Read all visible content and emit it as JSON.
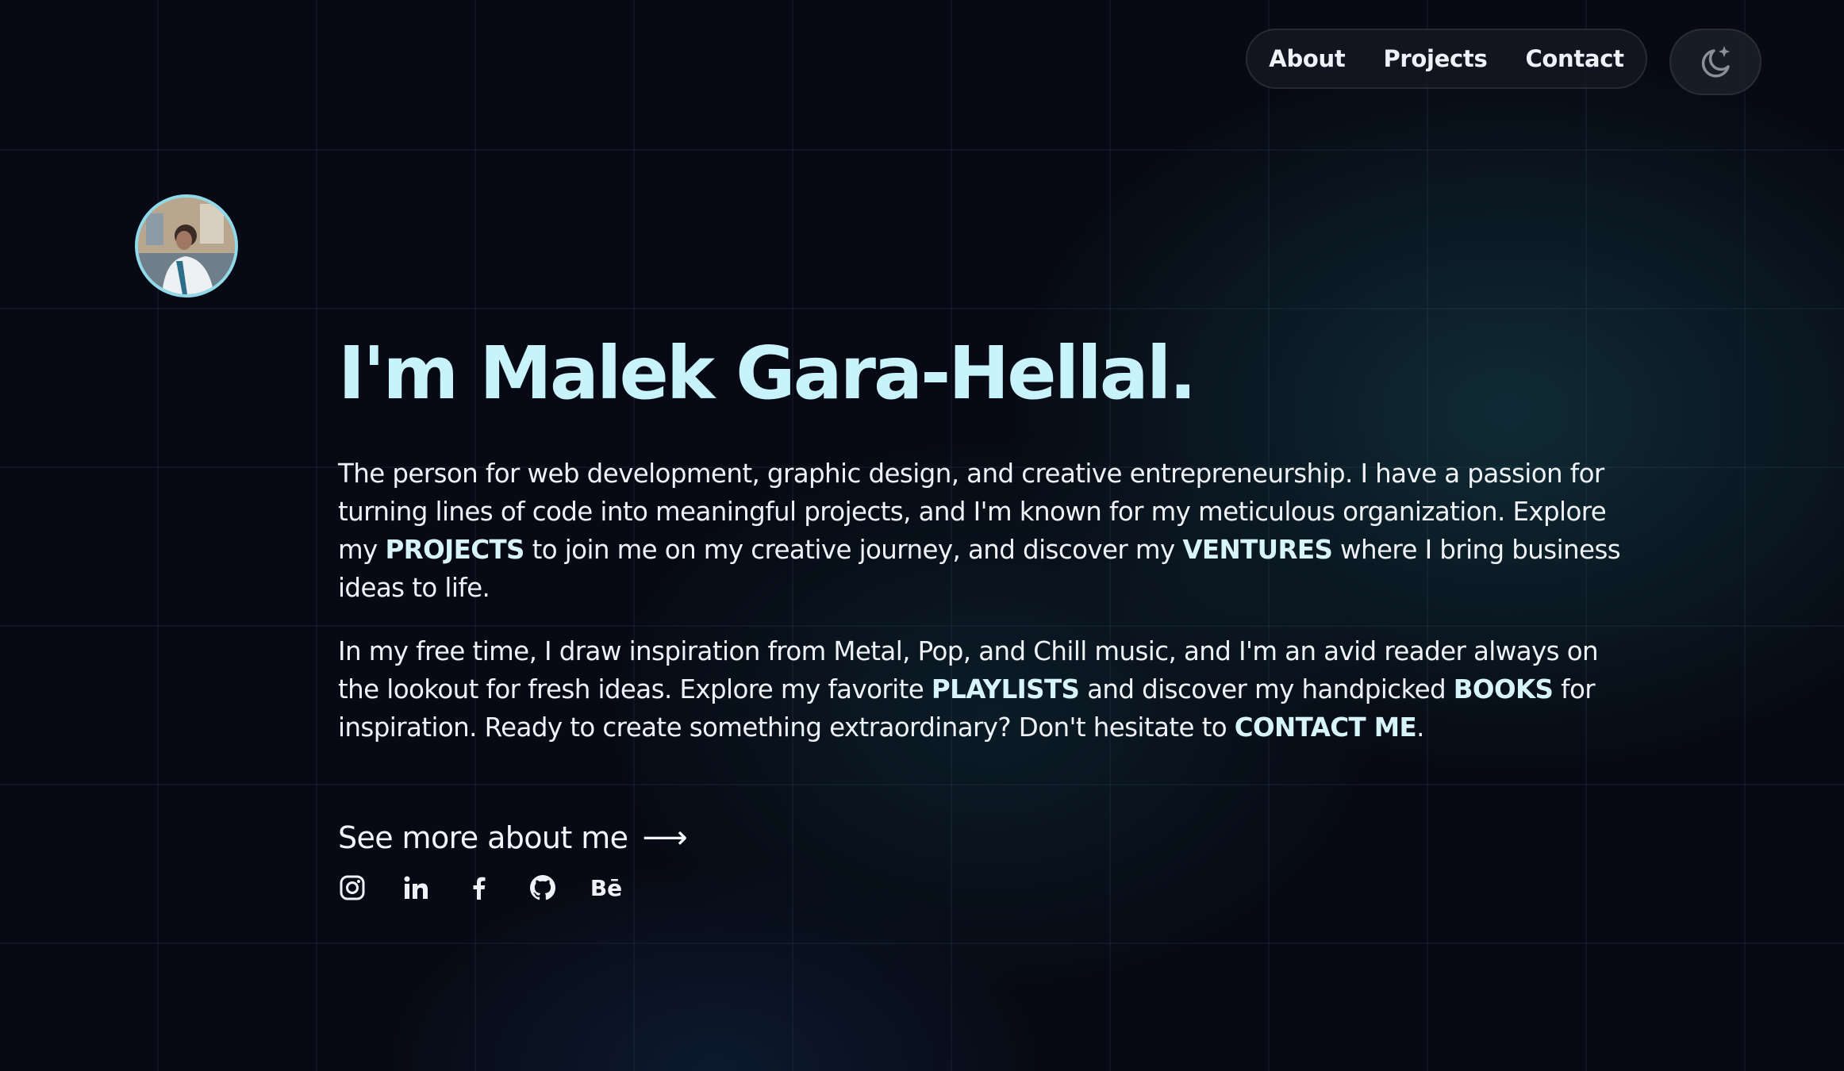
{
  "nav": {
    "items": [
      {
        "label": "About"
      },
      {
        "label": "Projects"
      },
      {
        "label": "Contact"
      }
    ]
  },
  "theme_toggle": {
    "icon": "moon-star-icon"
  },
  "avatar": {
    "icon": "avatar-photo"
  },
  "hero": {
    "title": "I'm Malek Gara-Hellal.",
    "p1": {
      "t1": "The person for web development, graphic design, and creative entrepreneurship. I have a passion for turning lines of code into meaningful projects, and I'm known for my meticulous organization. Explore my ",
      "b1": "PROJECTS",
      "t2": " to join me on my creative journey, and discover my ",
      "b2": "VENTURES",
      "t3": " where I bring business ideas to life."
    },
    "p2": {
      "t1": "In my free time, I draw inspiration from Metal, Pop, and Chill music, and I'm an avid reader always on the lookout for fresh ideas. Explore my favorite ",
      "b1": "PLAYLISTS",
      "t2": " and discover my handpicked ",
      "b2": "BOOKS",
      "t3": " for inspiration. Ready to create something extraordinary? Don't hesitate to ",
      "b3": "CONTACT ME",
      "t4": "."
    },
    "more_link": "See more about me",
    "more_arrow": "⟶"
  },
  "socials": [
    {
      "icon": "instagram-icon"
    },
    {
      "icon": "linkedin-icon"
    },
    {
      "icon": "facebook-icon"
    },
    {
      "icon": "github-icon"
    },
    {
      "icon": "behance-icon",
      "label": "Bē"
    }
  ],
  "colors": {
    "background": "#070a14",
    "accent": "#c9f3fb",
    "avatar_ring": "#8fd9e8"
  }
}
